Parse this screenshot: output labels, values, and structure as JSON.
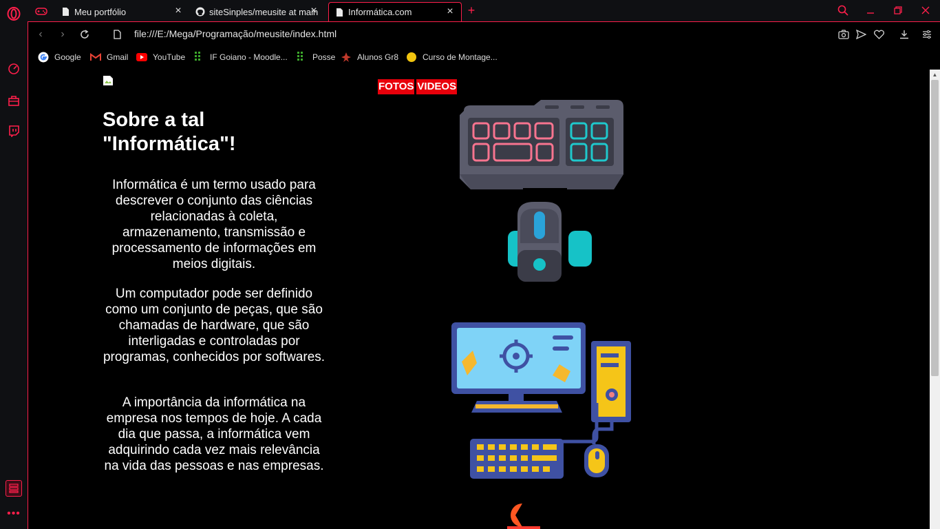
{
  "browser": {
    "tabs": [
      {
        "title": "Meu portfólio",
        "active": false
      },
      {
        "title": "siteSinples/meusite at main",
        "active": false
      },
      {
        "title": "Informática.com",
        "active": true
      }
    ],
    "url": "file:///E:/Mega/Programação/meusite/index.html",
    "bookmarks": [
      {
        "label": "Google",
        "icon": "google-icon"
      },
      {
        "label": "Gmail",
        "icon": "gmail-icon"
      },
      {
        "label": "YouTube",
        "icon": "youtube-icon"
      },
      {
        "label": "IF Goiano - Moodle...",
        "icon": "moodle-icon"
      },
      {
        "label": "Posse",
        "icon": "moodle-icon"
      },
      {
        "label": "Alunos Gr8",
        "icon": "alunos-icon"
      },
      {
        "label": "Curso de Montage...",
        "icon": "curso-icon"
      }
    ],
    "accent": "#ff1f4b"
  },
  "page": {
    "nav": {
      "fotos": "FOTOS",
      "videos": "VIDEOS"
    },
    "heading": "Sobre a tal \"Informática\"!",
    "paragraphs": [
      "Informática é um termo usado para descrever o conjunto das ciências relacionadas à coleta, armazenamento, transmissão e processamento de informações em meios digitais.",
      "Um computador pode ser definido como um conjunto de peças, que são chamadas de hardware, que são interligadas e controladas por programas, conhecidos por softwares.",
      "A importância da informática na empresa nos tempos de hoje. A cada dia que passa, a informática vem adquirindo cada vez mais relevância na vida das pessoas e nas empresas."
    ],
    "nav_color": "#e8000b"
  }
}
